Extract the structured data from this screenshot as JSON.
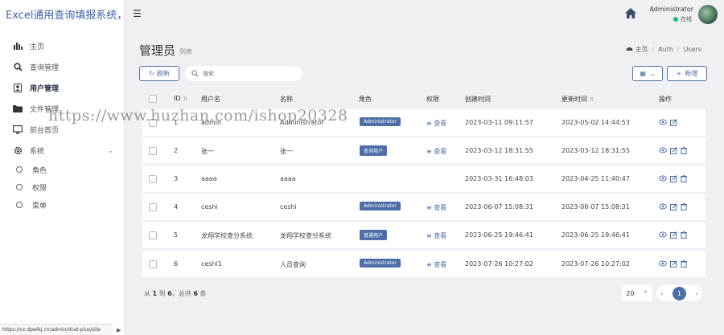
{
  "brand": {
    "title": "Excel通用查询填报系统，越"
  },
  "sidebar": {
    "items": [
      {
        "label": "主页",
        "icon": "bar-chart-icon"
      },
      {
        "label": "查询管理",
        "icon": "search-icon"
      },
      {
        "label": "用户管理",
        "icon": "user-icon",
        "active": true
      },
      {
        "label": "文件管理",
        "icon": "folder-icon"
      },
      {
        "label": "前台首页",
        "icon": "monitor-icon"
      },
      {
        "label": "系统",
        "icon": "gear-icon"
      }
    ],
    "subitems": [
      {
        "label": "角色"
      },
      {
        "label": "权限"
      },
      {
        "label": "菜单"
      }
    ]
  },
  "statusbar": {
    "url": "https://cx.dpwlkj.cn/admin/dcat-plus/site"
  },
  "topbar": {
    "user_name": "Administrator",
    "user_status": "在线"
  },
  "page": {
    "title": "管理员",
    "subtitle": "列表"
  },
  "breadcrumb": {
    "home": "主页",
    "items": [
      "Auth",
      "Users"
    ]
  },
  "toolbar": {
    "refresh_label": "刷新",
    "search_placeholder": "搜索",
    "new_label": "新增"
  },
  "table": {
    "headers": {
      "id": "ID",
      "username": "用户名",
      "name": "名称",
      "role": "角色",
      "permission": "权限",
      "created": "创建时间",
      "updated": "更新时间",
      "actions": "操作"
    },
    "rows": [
      {
        "id": "1",
        "username": "admin",
        "name": "Administrator",
        "role": "Administrator",
        "permission": "查看",
        "created": "2023-03-11 09:11:57",
        "updated": "2023-05-02 14:44:53",
        "deletable": false
      },
      {
        "id": "2",
        "username": "张一",
        "name": "张一",
        "role": "查询用户",
        "permission": "查看",
        "created": "2023-03-12 18:31:55",
        "updated": "2023-03-12 18:31:55",
        "deletable": true
      },
      {
        "id": "3",
        "username": "aaaa",
        "name": "aaaa",
        "role": "",
        "permission": "",
        "created": "2023-03-31 16:48:03",
        "updated": "2023-04-25 11:40:47",
        "deletable": true
      },
      {
        "id": "4",
        "username": "ceshi",
        "name": "ceshi",
        "role": "Administrator",
        "permission": "查看",
        "created": "2023-06-07 15:08:31",
        "updated": "2023-06-07 15:08:31",
        "deletable": true
      },
      {
        "id": "5",
        "username": "龙翔学校查分系统",
        "name": "龙翔学校查分系统",
        "role": "普通用户",
        "permission": "查看",
        "created": "2023-06-25 19:46:41",
        "updated": "2023-06-25 19:46:41",
        "deletable": true
      },
      {
        "id": "6",
        "username": "ceshi1",
        "name": "人员查询",
        "role": "Administrator",
        "permission": "查看",
        "created": "2023-07-26 10:27:02",
        "updated": "2023-07-26 10:27:02",
        "deletable": true
      }
    ]
  },
  "footer": {
    "prefix": "从",
    "from": "1",
    "to_word": "到",
    "to": "6",
    "total_word": "，总共",
    "total": "6",
    "suffix": "条",
    "per_page": "20",
    "current_page": "1"
  },
  "watermark": {
    "text": "https://www.huzhan.com/ishop20328"
  },
  "colors": {
    "accent": "#4e6ea8",
    "brand": "#3d63a8",
    "online": "#21b978"
  }
}
